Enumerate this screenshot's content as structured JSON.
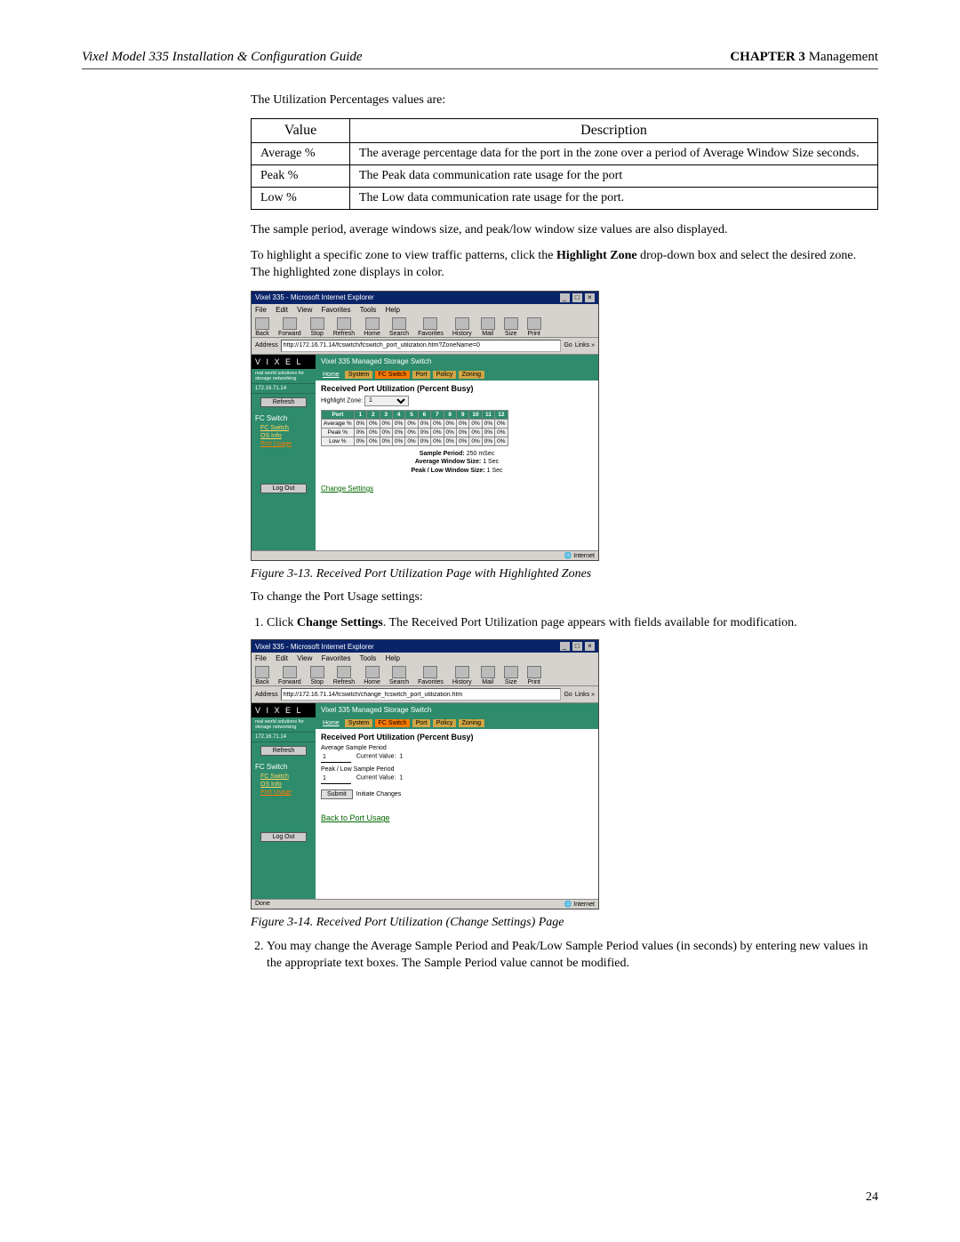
{
  "header": {
    "left": "Vixel Model 335 Installation & Configuration Guide",
    "chapter_label": "CHAPTER 3",
    "chapter_title": " Management"
  },
  "intro_line": "The Utilization Percentages values are:",
  "table_headers": {
    "col1": "Value",
    "col2": "Description"
  },
  "table_rows": [
    {
      "value": "Average %",
      "desc": "The average percentage data for the port in the zone over a period of Average Window Size seconds."
    },
    {
      "value": "Peak %",
      "desc": "The Peak data communication rate usage for the port"
    },
    {
      "value": "Low %",
      "desc": "The Low data communication rate usage for the port."
    }
  ],
  "para_sample": "The sample period, average windows size, and peak/low window size values are also displayed.",
  "para_highlight_pre": "To highlight a specific zone to view traffic patterns, click the ",
  "para_highlight_bold": "Highlight Zone",
  "para_highlight_post": " drop-down box and select the desired zone. The highlighted zone displays in color.",
  "shot_common": {
    "title": "Vixel 335 - Microsoft Internet Explorer",
    "win_min": "_",
    "win_max": "□",
    "win_close": "×",
    "menu": [
      "File",
      "Edit",
      "View",
      "Favorites",
      "Tools",
      "Help"
    ],
    "toolbar": [
      "Back",
      "Forward",
      "Stop",
      "Refresh",
      "Home",
      "Search",
      "Favorites",
      "History",
      "Mail",
      "Size",
      "Print"
    ],
    "addr_label": "Address",
    "go": "Go",
    "links": "Links »",
    "brand": "V I X E L",
    "brand_sub": "Vixel 335 Managed Storage Switch",
    "tagline": "real world solutions for storage networking",
    "ip": "172.16.71.14",
    "refresh_btn": "Refresh",
    "section": "FC Switch",
    "side_links": [
      "FC Switch",
      "OS Info",
      "Port Usage"
    ],
    "logout": "Log Out",
    "tabs": [
      "Home",
      "System",
      "FC Switch",
      "Port",
      "Policy",
      "Zoning"
    ],
    "content_title": "Received Port Utilization (Percent Busy)",
    "status_internet": "Internet"
  },
  "shot1": {
    "url": "http://172.16.71.14/fcswitch/fcswitch_port_utilization.htm?ZoneName=0",
    "highlight_label": "Highlight Zone:",
    "highlight_value": "1",
    "port_col": "Port",
    "ports": [
      "1",
      "2",
      "3",
      "4",
      "5",
      "6",
      "7",
      "8",
      "9",
      "10",
      "11",
      "12"
    ],
    "rows": [
      "Average %",
      "Peak %",
      "Low %"
    ],
    "cell": "0%",
    "sample_period_label": "Sample Period:",
    "sample_period_val": "  250 mSec",
    "avg_win_label": "Average Window Size:",
    "avg_win_val": "  1 Sec",
    "peak_low_label": "Peak / Low Window Size:",
    "peak_low_val": "  1 Sec",
    "change_settings": "Change Settings",
    "status_left": ""
  },
  "caption1": "Figure 3-13. Received Port Utilization Page with Highlighted Zones",
  "to_change": "To change the Port Usage settings:",
  "step1_pre": "Click ",
  "step1_bold": "Change Settings",
  "step1_post": ". The Received Port Utilization page appears with fields available for modification.",
  "shot2": {
    "url": "http://172.16.71.14/fcswitch/change_fcswitch_port_utilization.htm",
    "avg_sample_label": "Average Sample Period",
    "avg_sample_value": "1",
    "current_value_label": "Current Value:",
    "current_value": "1",
    "peak_low_label": "Peak / Low Sample Period",
    "peak_low_value": "1",
    "submit": "Submit",
    "initiate": "Initiate Changes",
    "back_link": "Back to Port Usage",
    "status_left": "Done"
  },
  "caption2": "Figure 3-14. Received Port Utilization (Change Settings) Page",
  "step2": "You may change the Average Sample Period and Peak/Low Sample Period values (in seconds) by entering new values in the appropriate text boxes. The Sample Period value cannot be modified.",
  "page_number": "24"
}
